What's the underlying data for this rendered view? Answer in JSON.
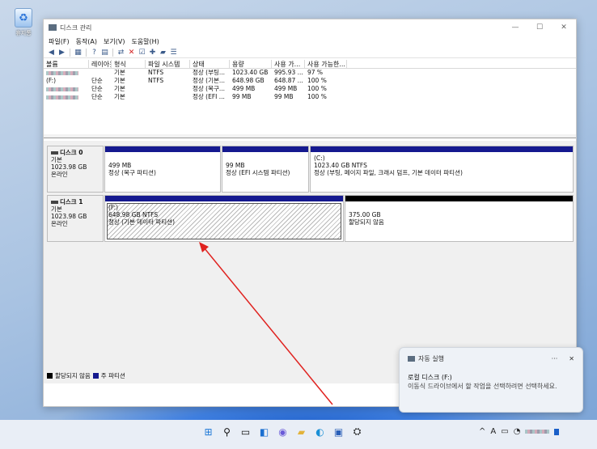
{
  "desktop": {
    "recycle_bin_label": "휴지통"
  },
  "window": {
    "title": "디스크 관리",
    "menu": [
      "파일(F)",
      "동작(A)",
      "보기(V)",
      "도움말(H)"
    ],
    "controls": {
      "minimize": "—",
      "maximize": "☐",
      "close": "✕"
    }
  },
  "volume_table": {
    "headers": [
      "볼륨",
      "레이아웃",
      "형식",
      "파일 시스템",
      "상태",
      "용량",
      "사용 가...",
      "사용 가능한..."
    ],
    "rows": [
      [
        "",
        "",
        "기본",
        "NTFS",
        "정상 (부팅...",
        "1023.40 GB",
        "995.93 ...",
        "97 %"
      ],
      [
        "(F:)",
        "단순",
        "기본",
        "NTFS",
        "정상 (기본...",
        "648.98 GB",
        "648.87 ...",
        "100 %"
      ],
      [
        "",
        "단순",
        "기본",
        "",
        "정상 (복구...",
        "499 MB",
        "499 MB",
        "100 %"
      ],
      [
        "",
        "단순",
        "기본",
        "",
        "정상 (EFI ...",
        "99 MB",
        "99 MB",
        "100 %"
      ]
    ]
  },
  "disks": [
    {
      "name": "디스크 0",
      "type": "기본",
      "size": "1023.98 GB",
      "status": "온라인",
      "partitions": [
        {
          "line1": "",
          "line2": "499 MB",
          "line3": "정상 (복구 파티션)"
        },
        {
          "line1": "",
          "line2": "99 MB",
          "line3": "정상 (EFI 시스템 파티션)"
        },
        {
          "line1": "(C:)",
          "line2": "1023.40 GB NTFS",
          "line3": "정상 (부팅, 페이지 파일, 크래시 덤프, 기본 데이터 파티션)"
        }
      ]
    },
    {
      "name": "디스크 1",
      "type": "기본",
      "size": "1023.98 GB",
      "status": "온라인",
      "partitions": [
        {
          "line1": "(F:)",
          "line2": "648.98 GB NTFS",
          "line3": "정상 (기본 데이터 파티션)"
        },
        {
          "line1": "",
          "line2": "375.00 GB",
          "line3": "할당되지 않음"
        }
      ]
    }
  ],
  "legend": {
    "unallocated": "할당되지 않음",
    "primary": "주 파티션"
  },
  "toast": {
    "source": "자동 실행",
    "more": "···",
    "close": "✕",
    "title": "로컬 디스크 (F:)",
    "message": "이동식 드라이브에서 할 작업을 선택하려면 선택하세요."
  },
  "tray": {
    "chevron": "^",
    "ime": "A"
  },
  "colors": {
    "primary_partition": "#15198f",
    "unallocated": "#000000",
    "annotation_arrow": "#e0221f"
  }
}
